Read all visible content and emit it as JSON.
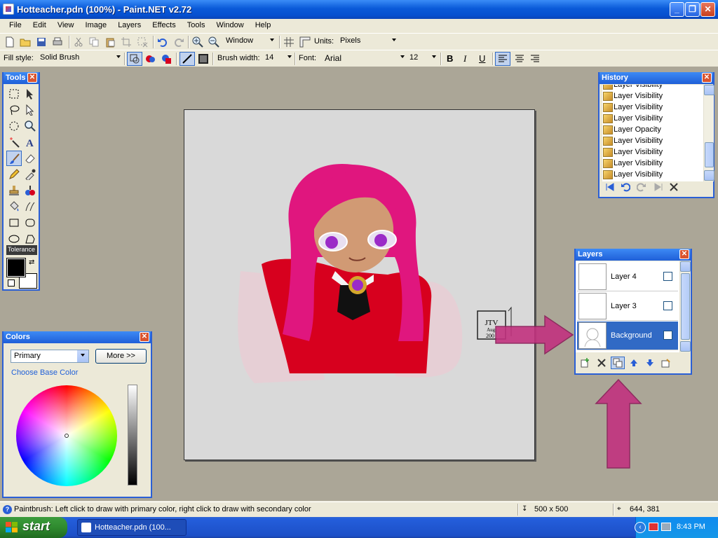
{
  "window": {
    "title": "Hotteacher.pdn (100%) - Paint.NET v2.72",
    "minimize": "_",
    "maximize": "❐",
    "close": "✕"
  },
  "menu": [
    "File",
    "Edit",
    "View",
    "Image",
    "Layers",
    "Effects",
    "Tools",
    "Window",
    "Help"
  ],
  "toolbar1": {
    "zoom_mode": "Window",
    "units_label": "Units:",
    "units_value": "Pixels"
  },
  "toolbar2": {
    "fill_style_label": "Fill style:",
    "fill_style_value": "Solid Brush",
    "brush_width_label": "Brush width:",
    "brush_width_value": "14",
    "font_label": "Font:",
    "font_value": "Arial",
    "font_size": "12",
    "bold": "B",
    "italic": "I",
    "underline": "U"
  },
  "tools_panel": {
    "title": "Tools",
    "tolerance": "Tolerance"
  },
  "colors_panel": {
    "title": "Colors",
    "mode": "Primary",
    "more_button": "More >>",
    "choose_base": "Choose Base Color",
    "primary_color": "#000000",
    "secondary_color": "#ffffff"
  },
  "history_panel": {
    "title": "History",
    "items": [
      "Layer Visibility",
      "Layer Visibility",
      "Layer Visibility",
      "Layer Visibility",
      "Layer Opacity",
      "Layer Visibility",
      "Layer Visibility",
      "Layer Visibility",
      "Layer Visibility"
    ]
  },
  "layers_panel": {
    "title": "Layers",
    "layers": [
      {
        "name": "Layer 4",
        "selected": false
      },
      {
        "name": "Layer 3",
        "selected": false
      },
      {
        "name": "Background",
        "selected": true
      }
    ]
  },
  "artwork": {
    "signature_initials": "JTV",
    "signature_line2": "Aug.",
    "signature_year": "200"
  },
  "status": {
    "message": "Paintbrush: Left click to draw with primary color, right click to draw with secondary color",
    "image_size": "500 x 500",
    "cursor_pos": "644, 381"
  },
  "taskbar": {
    "start": "start",
    "task": "Hotteacher.pdn (100...",
    "clock": "8:43 PM"
  },
  "colors": {
    "title_bar": "#0a5ad8",
    "accent_arrow": "#c2327f",
    "hair": "#e0167e",
    "shirt": "#d7001e",
    "selection": "#316ac5"
  }
}
